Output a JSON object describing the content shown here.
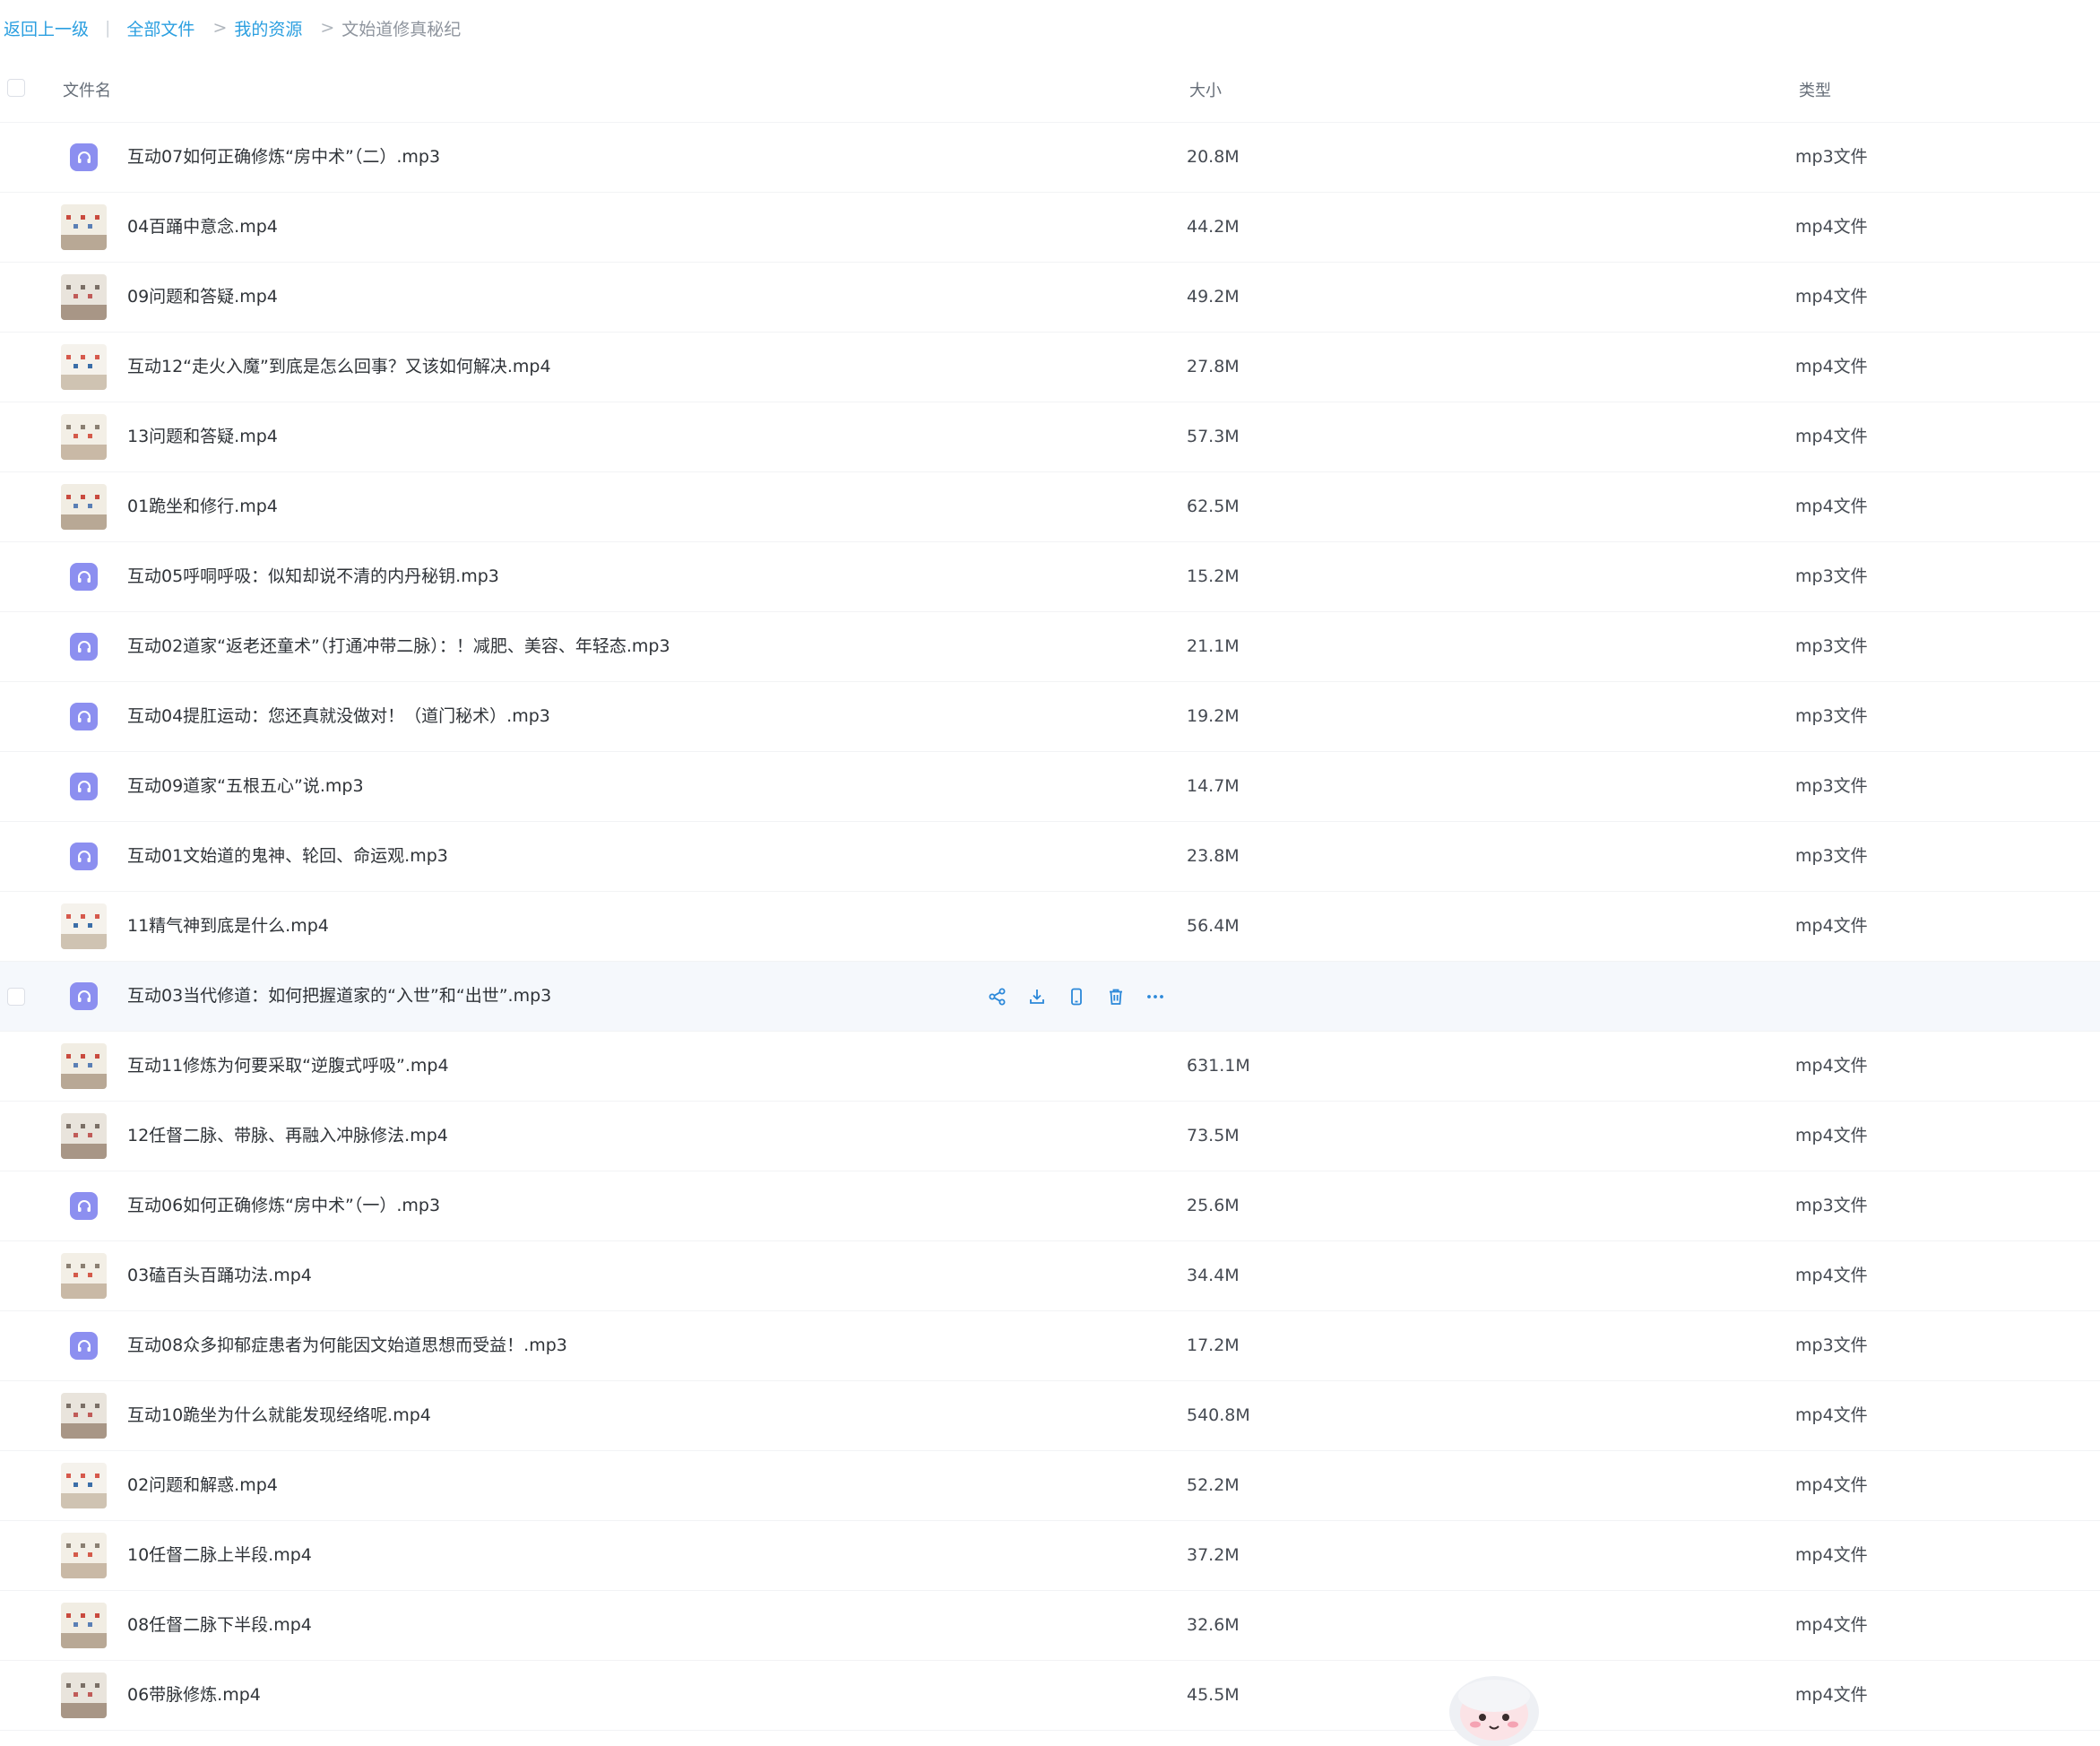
{
  "breadcrumb": {
    "back": "返回上一级",
    "all_files": "全部文件",
    "my_resources": "我的资源",
    "current": "文始道修真秘纪",
    "sep": ">"
  },
  "table": {
    "col_name": "文件名",
    "col_size": "大小",
    "col_type": "类型"
  },
  "colors": {
    "link": "#2b9fe0",
    "audio_icon": "#8c8ff0",
    "action_icon": "#2b88d9",
    "hover_row": "#f5f8fc"
  },
  "rows": [
    {
      "name": "互动07如何正确修炼“房中术”（二）.mp3",
      "size": "20.8M",
      "type": "mp3文件",
      "kind": "audio"
    },
    {
      "name": "04百踊中意念.mp4",
      "size": "44.2M",
      "type": "mp4文件",
      "kind": "video"
    },
    {
      "name": "09问题和答疑.mp4",
      "size": "49.2M",
      "type": "mp4文件",
      "kind": "video"
    },
    {
      "name": "互动12“走火入魔”到底是怎么回事？又该如何解决.mp4",
      "size": "27.8M",
      "type": "mp4文件",
      "kind": "video"
    },
    {
      "name": "13问题和答疑.mp4",
      "size": "57.3M",
      "type": "mp4文件",
      "kind": "video"
    },
    {
      "name": "01跪坐和修行.mp4",
      "size": "62.5M",
      "type": "mp4文件",
      "kind": "video"
    },
    {
      "name": "互动05呼哃呼吸：似知却说不清的内丹秘钥.mp3",
      "size": "15.2M",
      "type": "mp3文件",
      "kind": "audio"
    },
    {
      "name": "互动02道家“返老还童术”（打通冲带二脉）：！减肥、美容、年轻态.mp3",
      "size": "21.1M",
      "type": "mp3文件",
      "kind": "audio"
    },
    {
      "name": "互动04提肛运动：您还真就没做对！（道门秘术）.mp3",
      "size": "19.2M",
      "type": "mp3文件",
      "kind": "audio"
    },
    {
      "name": "互动09道家“五根五心”说.mp3",
      "size": "14.7M",
      "type": "mp3文件",
      "kind": "audio"
    },
    {
      "name": "互动01文始道的鬼神、轮回、命运观.mp3",
      "size": "23.8M",
      "type": "mp3文件",
      "kind": "audio"
    },
    {
      "name": "11精气神到底是什么.mp4",
      "size": "56.4M",
      "type": "mp4文件",
      "kind": "video"
    },
    {
      "name": "互动03当代修道：如何把握道家的“入世”和“出世”.mp3",
      "size": "",
      "type": "",
      "kind": "audio",
      "hover": true
    },
    {
      "name": "互动11修炼为何要采取“逆腹式呼吸”.mp4",
      "size": "631.1M",
      "type": "mp4文件",
      "kind": "video"
    },
    {
      "name": "12任督二脉、带脉、再融入冲脉修法.mp4",
      "size": "73.5M",
      "type": "mp4文件",
      "kind": "video"
    },
    {
      "name": "互动06如何正确修炼“房中术”（一）.mp3",
      "size": "25.6M",
      "type": "mp3文件",
      "kind": "audio"
    },
    {
      "name": "03磕百头百踊功法.mp4",
      "size": "34.4M",
      "type": "mp4文件",
      "kind": "video"
    },
    {
      "name": "互动08众多抑郁症患者为何能因文始道思想而受益！.mp3",
      "size": "17.2M",
      "type": "mp3文件",
      "kind": "audio"
    },
    {
      "name": "互动10跪坐为什么就能发现经络呢.mp4",
      "size": "540.8M",
      "type": "mp4文件",
      "kind": "video"
    },
    {
      "name": "02问题和解惑.mp4",
      "size": "52.2M",
      "type": "mp4文件",
      "kind": "video"
    },
    {
      "name": "10任督二脉上半段.mp4",
      "size": "37.2M",
      "type": "mp4文件",
      "kind": "video"
    },
    {
      "name": "08任督二脉下半段.mp4",
      "size": "32.6M",
      "type": "mp4文件",
      "kind": "video"
    },
    {
      "name": "06带脉修炼.mp4",
      "size": "45.5M",
      "type": "mp4文件",
      "kind": "video"
    }
  ],
  "row_actions": [
    {
      "icon": "share-icon"
    },
    {
      "icon": "download-icon"
    },
    {
      "icon": "phone-icon"
    },
    {
      "icon": "delete-icon"
    },
    {
      "icon": "more-icon"
    }
  ]
}
